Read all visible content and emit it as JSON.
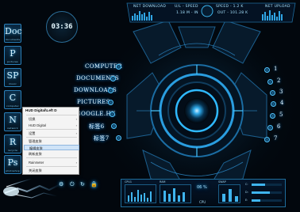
{
  "dock": {
    "tiles": [
      {
        "letter": "Doc",
        "tag": "documents"
      },
      {
        "letter": "P",
        "tag": "pictures"
      },
      {
        "letter": "SP",
        "tag": "music"
      },
      {
        "letter": "C",
        "tag": "computer"
      },
      {
        "letter": "N",
        "tag": "network"
      },
      {
        "letter": "R",
        "tag": "recycle"
      },
      {
        "letter": "Ps",
        "tag": "photoshop"
      }
    ]
  },
  "clock": {
    "time": "03:36",
    "date": ""
  },
  "top_stats": {
    "net_download": "NET DOWNLOAD",
    "speed_mid": "U/L - SPEED",
    "speed_title": "SPEED - 1.2 K",
    "net_upload": "NET UPLOAD",
    "in_value": "1.18 M - IN",
    "out_value": "OUT - 101.28 K"
  },
  "menu": {
    "left_items": [
      "COMPUTER",
      "DOCUMENTS",
      "DOWNLOADS",
      "PICTURES",
      "GOOGLE.HK",
      "标签6",
      "标签7"
    ],
    "right_items": [
      "1",
      "2",
      "3",
      "4",
      "5",
      "6",
      "7"
    ]
  },
  "context_menu": {
    "title": "HUD Digital\\Left D",
    "items": [
      {
        "label": "切换",
        "arrow": "›"
      },
      {
        "label": "HUD Digital",
        "arrow": "›"
      },
      {
        "label": "设置",
        "arrow": "›"
      },
      {
        "label": "管理皮肤",
        "arrow": ""
      },
      {
        "label": "编辑皮肤",
        "arrow": "",
        "highlight": true
      },
      {
        "label": "刷新皮肤",
        "arrow": ""
      },
      {
        "label": "Rainmeter",
        "arrow": "›"
      },
      {
        "label": "关闭皮肤",
        "arrow": ""
      }
    ]
  },
  "bottom_panel": {
    "cpu1": "CPU1",
    "cpu2": "CPU2",
    "ram_label": "RAM",
    "cpu_center": "CPU",
    "cpu_pct": "06 %",
    "swap_label": "SWAP",
    "disk_c": "C:",
    "disk_d": "D:",
    "disk_e": "E:"
  },
  "accent": "#2fb9ff"
}
